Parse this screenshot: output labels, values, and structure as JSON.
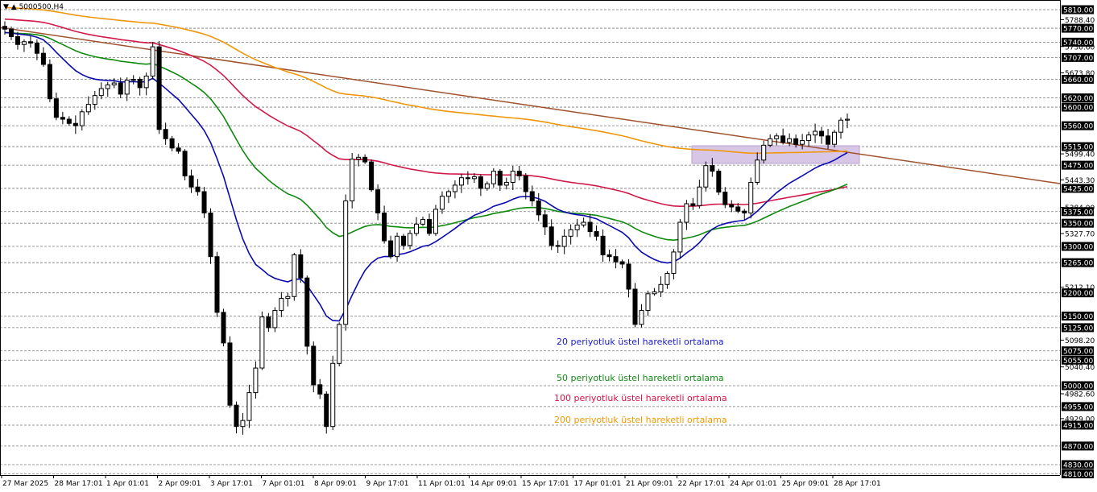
{
  "symbol_label": "▼ ▲ 5000500,H4",
  "chart_data": {
    "type": "candlestick",
    "y_axis": {
      "range": [
        4800,
        5820
      ],
      "labels": [
        "5810.00",
        "5788.40",
        "5770.00",
        "5740.00",
        "5730.60",
        "5707.00",
        "5673.80",
        "5660.00",
        "5620.00",
        "5600.00",
        "5560.00",
        "5515.00",
        "5499.40",
        "5475.00",
        "5443.30",
        "5425.00",
        "5384.00",
        "5375.00",
        "5350.00",
        "5327.70",
        "5300.00",
        "5265.00",
        "5212.10",
        "5200.00",
        "5150.00",
        "5125.00",
        "5098.20",
        "5075.00",
        "5055.00",
        "5040.40",
        "5000.00",
        "4982.60",
        "4955.00",
        "4929.00",
        "4915.00",
        "4870.00",
        "4830.00",
        "4810.00"
      ],
      "highlighted": [
        "5810.00",
        "5770.00",
        "5740.00",
        "5707.00",
        "5660.00",
        "5620.00",
        "5600.00",
        "5560.00",
        "5515.00",
        "5475.00",
        "5425.00",
        "5375.00",
        "5350.00",
        "5300.00",
        "5265.00",
        "5200.00",
        "5150.00",
        "5125.00",
        "5075.00",
        "5055.00",
        "5000.00",
        "4955.00",
        "4915.00",
        "4870.00",
        "4830.00",
        "4810.00"
      ]
    },
    "x_axis": {
      "labels": [
        "27 Mar 2025",
        "28 Mar 17:01",
        "1 Apr 01:01",
        "2 Apr 09:01",
        "3 Apr 17:01",
        "7 Apr 01:01",
        "8 Apr 09:01",
        "9 Apr 17:01",
        "11 Apr 01:01",
        "14 Apr 09:01",
        "15 Apr 17:01",
        "17 Apr 01:01",
        "21 Apr 09:01",
        "22 Apr 17:01",
        "24 Apr 01:01",
        "25 Apr 09:01",
        "28 Apr 17:01"
      ]
    },
    "closes": [
      5768,
      5752,
      5735,
      5741,
      5738,
      5716,
      5692,
      5618,
      5578,
      5574,
      5565,
      5560,
      5590,
      5606,
      5625,
      5640,
      5648,
      5652,
      5628,
      5658,
      5660,
      5642,
      5667,
      5730,
      5552,
      5532,
      5512,
      5505,
      5452,
      5428,
      5418,
      5372,
      5278,
      5158,
      5092,
      4958,
      4912,
      4925,
      4985,
      5038,
      5148,
      5125,
      5162,
      5188,
      5192,
      5282,
      5232,
      5085,
      5002,
      4982,
      4912,
      5048,
      5132,
      5398,
      5488,
      5492,
      5482,
      5422,
      5372,
      5312,
      5278,
      5322,
      5302,
      5328,
      5348,
      5358,
      5328,
      5380,
      5408,
      5418,
      5432,
      5448,
      5446,
      5450,
      5425,
      5435,
      5462,
      5432,
      5438,
      5462,
      5452,
      5418,
      5398,
      5368,
      5342,
      5302,
      5300,
      5322,
      5336,
      5346,
      5352,
      5332,
      5322,
      5282,
      5278,
      5267,
      5262,
      5208,
      5132,
      5162,
      5198,
      5202,
      5218,
      5242,
      5288,
      5352,
      5392,
      5388,
      5428,
      5474,
      5462,
      5417,
      5390,
      5385,
      5376,
      5372,
      5438,
      5486,
      5518,
      5532,
      5538,
      5524,
      5532,
      5520,
      5528,
      5540,
      5548,
      5538,
      5520,
      5546,
      5572,
      5574
    ]
  },
  "annotations": [
    {
      "text": "20 periyotluk üstel hareketli ortalama",
      "color": "#1a1ac8"
    },
    {
      "text": "50 periyotluk üstel hareketli ortalama",
      "color": "#118811"
    },
    {
      "text": "100 periyotluk üstel hareketli ortalama",
      "color": "#dd1144"
    },
    {
      "text": "200 periyotluk üstel hareketli ortalama",
      "color": "#ee9900"
    }
  ],
  "colors": {
    "ema20": "#0a0ab0",
    "ema50": "#0e8a0e",
    "ema100": "#d21a4a",
    "ema200": "#f0960a",
    "trendline": "#a0522d",
    "zone_fill": "#d8c6e6",
    "zone_stroke": "#b8a2cc",
    "grid": "#7a7a7a",
    "label_bg": "#000000",
    "label_fg": "#ffffff"
  }
}
